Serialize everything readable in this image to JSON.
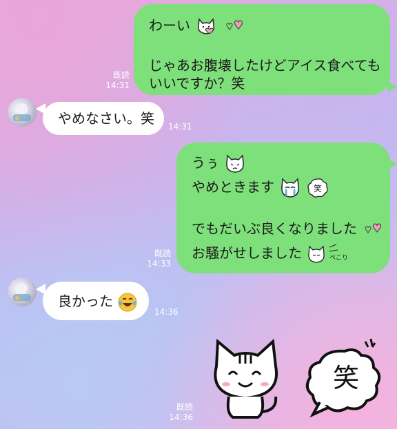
{
  "messages": [
    {
      "sender": "me",
      "lines": [
        "わーい",
        "",
        "じゃあお腹壊したけどアイス食べても",
        "いいですか？笑"
      ],
      "read_label": "既読",
      "time": "14:31"
    },
    {
      "sender": "other",
      "lines": [
        "やめなさい。笑"
      ],
      "time": "14:31"
    },
    {
      "sender": "me",
      "lines": [
        "うぅ",
        "やめときます",
        "",
        "でもだいぶ良くなりました",
        "お騒がせしました"
      ],
      "read_label": "既読",
      "time": "14:33"
    },
    {
      "sender": "other",
      "lines": [
        "良かった"
      ],
      "time": "14:36"
    },
    {
      "sender": "me",
      "sticker": "laughing-cat-sticker",
      "sticker_text": "笑",
      "read_label": "既読",
      "time": "14:36"
    }
  ],
  "sticker_mini_text": "ペこり",
  "colors": {
    "my_bubble": "#7ee07b",
    "their_bubble": "#ffffff"
  }
}
